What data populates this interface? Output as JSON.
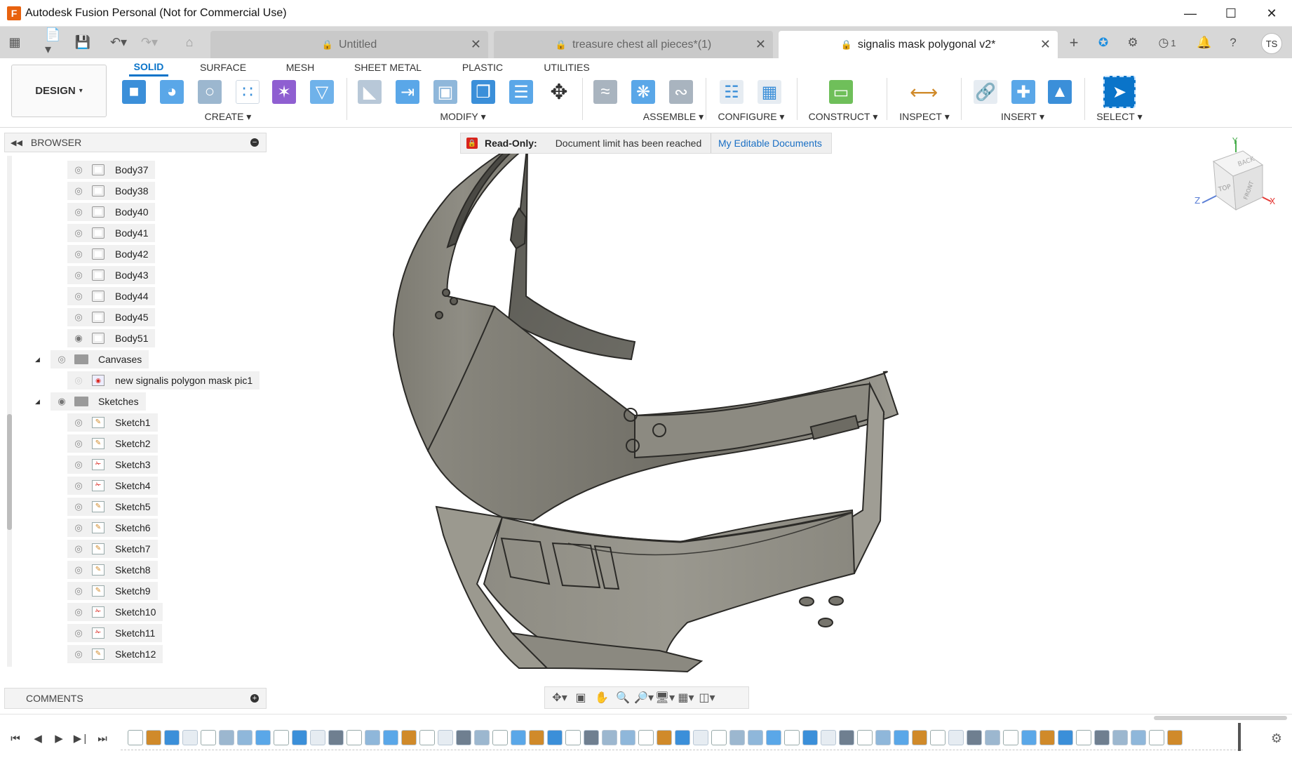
{
  "window": {
    "title": "Autodesk Fusion Personal (Not for Commercial Use)",
    "logo_letter": "F"
  },
  "tabs": [
    {
      "label": "Untitled",
      "active": false
    },
    {
      "label": "treasure chest all pieces*(1)",
      "active": false
    },
    {
      "label": "signalis mask polygonal v2*",
      "active": true
    }
  ],
  "tab_right": {
    "jobs_count": "1",
    "avatar": "TS"
  },
  "toolbar": {
    "workspace": "DESIGN",
    "workspace_tabs": [
      "SOLID",
      "SURFACE",
      "MESH",
      "SHEET METAL",
      "PLASTIC",
      "UTILITIES"
    ],
    "groups": [
      "CREATE",
      "MODIFY",
      "ASSEMBLE",
      "CONFIGURE",
      "CONSTRUCT",
      "INSPECT",
      "INSERT",
      "SELECT"
    ]
  },
  "browser": {
    "title": "BROWSER",
    "bodies": [
      "Body37",
      "Body38",
      "Body40",
      "Body41",
      "Body42",
      "Body43",
      "Body44",
      "Body45",
      "Body51"
    ],
    "canvases_folder": "Canvases",
    "canvas_item": "new signalis polygon mask pic1",
    "sketches_folder": "Sketches",
    "sketches": [
      "Sketch1",
      "Sketch2",
      "Sketch3",
      "Sketch4",
      "Sketch5",
      "Sketch6",
      "Sketch7",
      "Sketch8",
      "Sketch9",
      "Sketch10",
      "Sketch11",
      "Sketch12"
    ]
  },
  "comments": {
    "title": "COMMENTS"
  },
  "banner": {
    "label": "Read-Only:",
    "message": "Document limit has been reached",
    "link": "My Editable Documents"
  },
  "viewcube": {
    "y": "Y",
    "x": "X",
    "z": "Z",
    "top": "TOP",
    "front": "FRONT",
    "back": "BACK"
  },
  "colors": {
    "accent": "#0a74c9",
    "model_dark": "#5f5e57",
    "model_light": "#a9a79e",
    "readonly_red": "#d9241c"
  }
}
